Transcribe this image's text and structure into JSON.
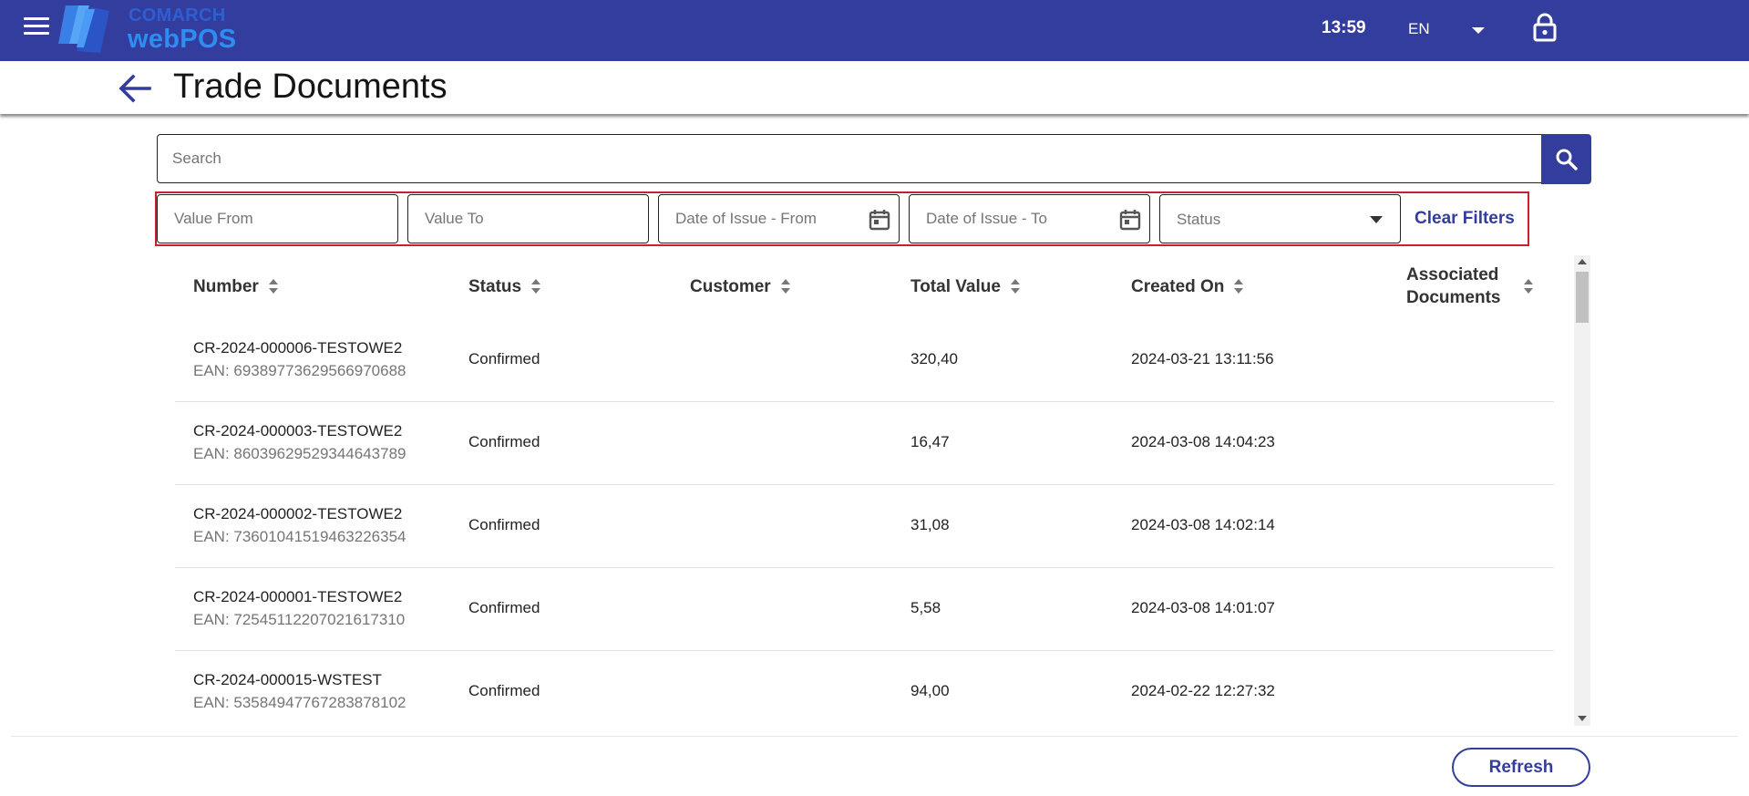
{
  "header": {
    "brand_line1": "COMARCH",
    "brand_line2": "webPOS",
    "time": "13:59",
    "language": "EN",
    "colors": {
      "bar": "#333d9e",
      "brand_dark": "#2d5fd3",
      "brand_light": "#2f8cf0"
    },
    "icons": [
      "menu-icon",
      "app-logo",
      "chevron-down-icon",
      "lock-icon"
    ]
  },
  "page": {
    "title": "Trade Documents"
  },
  "search": {
    "placeholder": "Search"
  },
  "filters": {
    "value_from": "Value From",
    "value_to": "Value To",
    "date_from": "Date of Issue - From",
    "date_to": "Date of Issue - To",
    "status": "Status",
    "clear_label": "Clear Filters"
  },
  "table": {
    "columns": [
      {
        "label": "Number"
      },
      {
        "label": "Status"
      },
      {
        "label": "Customer"
      },
      {
        "label": "Total Value"
      },
      {
        "label": "Created On"
      },
      {
        "label": "Associated Documents"
      }
    ],
    "rows": [
      {
        "number": "CR-2024-000006-TESTOWE2",
        "ean": "EAN: 69389773629566970688",
        "status": "Confirmed",
        "customer": "",
        "total": "320,40",
        "created": "2024-03-21 13:11:56",
        "associated": ""
      },
      {
        "number": "CR-2024-000003-TESTOWE2",
        "ean": "EAN: 86039629529344643789",
        "status": "Confirmed",
        "customer": "",
        "total": "16,47",
        "created": "2024-03-08 14:04:23",
        "associated": ""
      },
      {
        "number": "CR-2024-000002-TESTOWE2",
        "ean": "EAN: 73601041519463226354",
        "status": "Confirmed",
        "customer": "",
        "total": "31,08",
        "created": "2024-03-08 14:02:14",
        "associated": ""
      },
      {
        "number": "CR-2024-000001-TESTOWE2",
        "ean": "EAN: 72545112207021617310",
        "status": "Confirmed",
        "customer": "",
        "total": "5,58",
        "created": "2024-03-08 14:01:07",
        "associated": ""
      },
      {
        "number": "CR-2024-000015-WSTEST",
        "ean": "EAN: 53584947767283878102",
        "status": "Confirmed",
        "customer": "",
        "total": "94,00",
        "created": "2024-02-22 12:27:32",
        "associated": ""
      }
    ]
  },
  "footer": {
    "refresh_label": "Refresh"
  }
}
